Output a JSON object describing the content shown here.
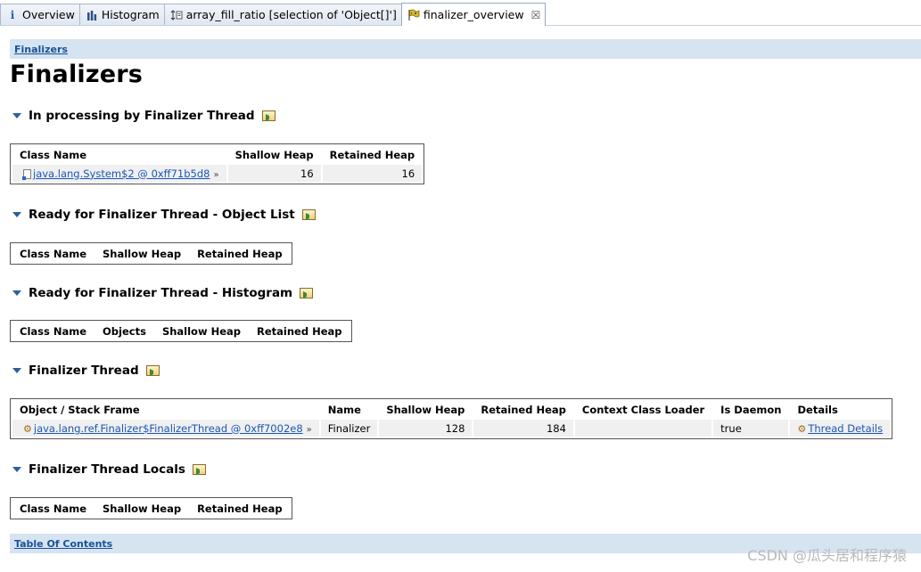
{
  "tabs": [
    {
      "label": "Overview",
      "icon": "info-icon"
    },
    {
      "label": "Histogram",
      "icon": "histogram-icon"
    },
    {
      "label": "array_fill_ratio  [selection of 'Object[]']",
      "icon": "query-icon"
    },
    {
      "label": "finalizer_overview",
      "icon": "report-icon",
      "active": true
    }
  ],
  "breadcrumb": "Finalizers",
  "title": "Finalizers",
  "sections": {
    "processing": {
      "title": "In processing by Finalizer Thread",
      "headers": [
        "Class Name",
        "Shallow Heap",
        "Retained Heap"
      ],
      "rows": [
        {
          "name": "java.lang.System$2 @ 0xff71b5d8",
          "shallow": "16",
          "retained": "16"
        }
      ]
    },
    "ready_list": {
      "title": "Ready for Finalizer Thread - Object List",
      "headers": [
        "Class Name",
        "Shallow Heap",
        "Retained Heap"
      ]
    },
    "ready_histogram": {
      "title": "Ready for Finalizer Thread - Histogram",
      "headers": [
        "Class Name",
        "Objects",
        "Shallow Heap",
        "Retained Heap"
      ]
    },
    "thread": {
      "title": "Finalizer Thread",
      "headers": [
        "Object / Stack Frame",
        "Name",
        "Shallow Heap",
        "Retained Heap",
        "Context Class Loader",
        "Is Daemon",
        "Details"
      ],
      "rows": [
        {
          "object": "java.lang.ref.Finalizer$FinalizerThread @ 0xff7002e8",
          "name": "Finalizer",
          "shallow": "128",
          "retained": "184",
          "loader": "",
          "daemon": "true",
          "details": "Thread Details"
        }
      ]
    },
    "locals": {
      "title": "Finalizer Thread Locals",
      "headers": [
        "Class Name",
        "Shallow Heap",
        "Retained Heap"
      ]
    }
  },
  "footer_link": "Table Of Contents",
  "watermark": "CSDN @瓜头居和程序猿",
  "colors": {
    "section_bar": "#d6e4f1",
    "link": "#1a56b8",
    "cell_bg": "#f0f0f0"
  }
}
